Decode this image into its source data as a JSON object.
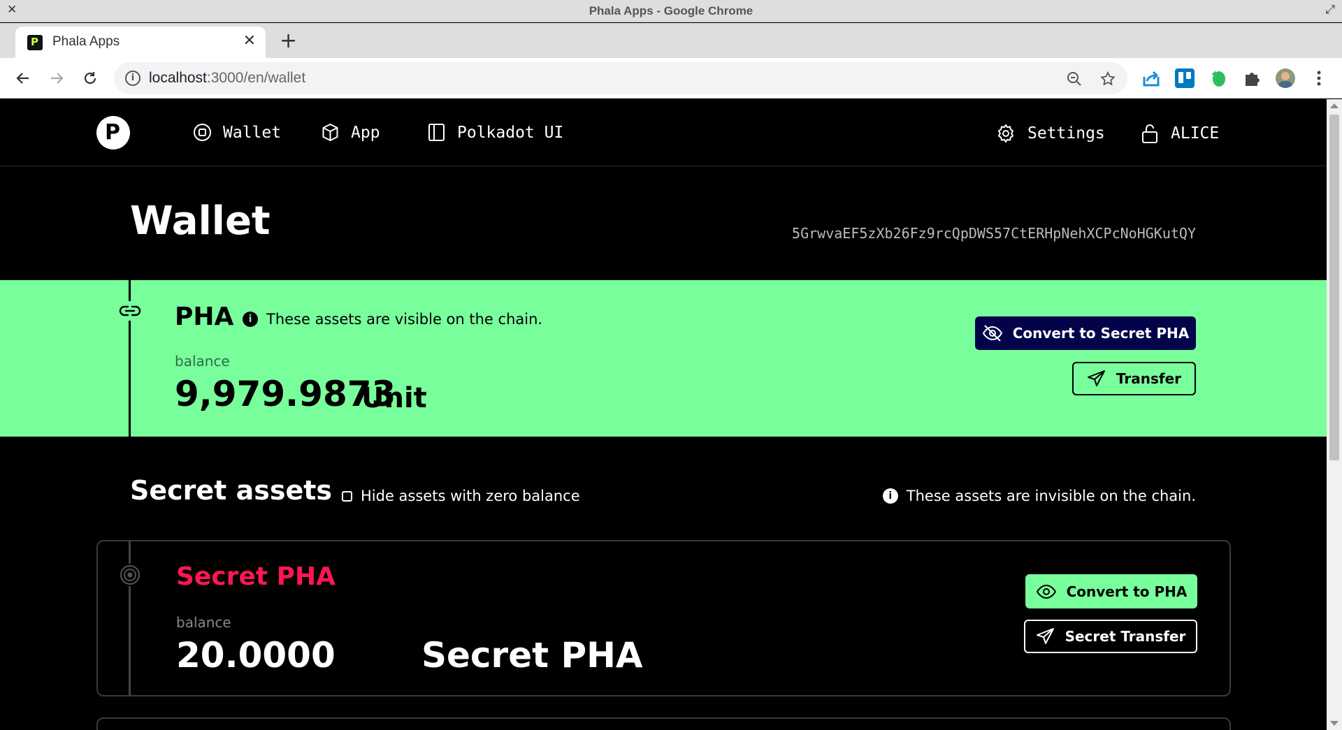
{
  "window": {
    "title": "Phala Apps - Google Chrome"
  },
  "browser": {
    "tab_title": "Phala Apps",
    "url_host": "localhost",
    "url_path": ":3000/en/wallet"
  },
  "nav": {
    "logo_letter": "P",
    "items": [
      {
        "label": "Wallet"
      },
      {
        "label": "App"
      },
      {
        "label": "Polkadot UI"
      }
    ],
    "settings_label": "Settings",
    "account_label": "ALICE"
  },
  "wallet": {
    "title": "Wallet",
    "address": "5GrwvaEF5zXb26Fz9rcQpDWS57CtERHpNehXCPcNoHGKutQY"
  },
  "pha": {
    "name": "PHA",
    "info": "These assets are visible on the chain.",
    "balance_label": "balance",
    "balance_value": "9,979.9873",
    "balance_unit": "Unit",
    "convert_label": "Convert to Secret PHA",
    "transfer_label": "Transfer"
  },
  "secret": {
    "heading": "Secret assets",
    "hide_zero_label": "Hide assets with zero balance",
    "info": "These assets are invisible on the chain.",
    "card": {
      "name": "Secret PHA",
      "balance_label": "balance",
      "balance_value": "20.0000",
      "balance_unit": "Secret PHA",
      "convert_label": "Convert to PHA",
      "transfer_label": "Secret Transfer"
    }
  },
  "colors": {
    "accent_green": "#78ff9b",
    "dark_navy": "#03034a",
    "secret_red": "#ff1653"
  }
}
